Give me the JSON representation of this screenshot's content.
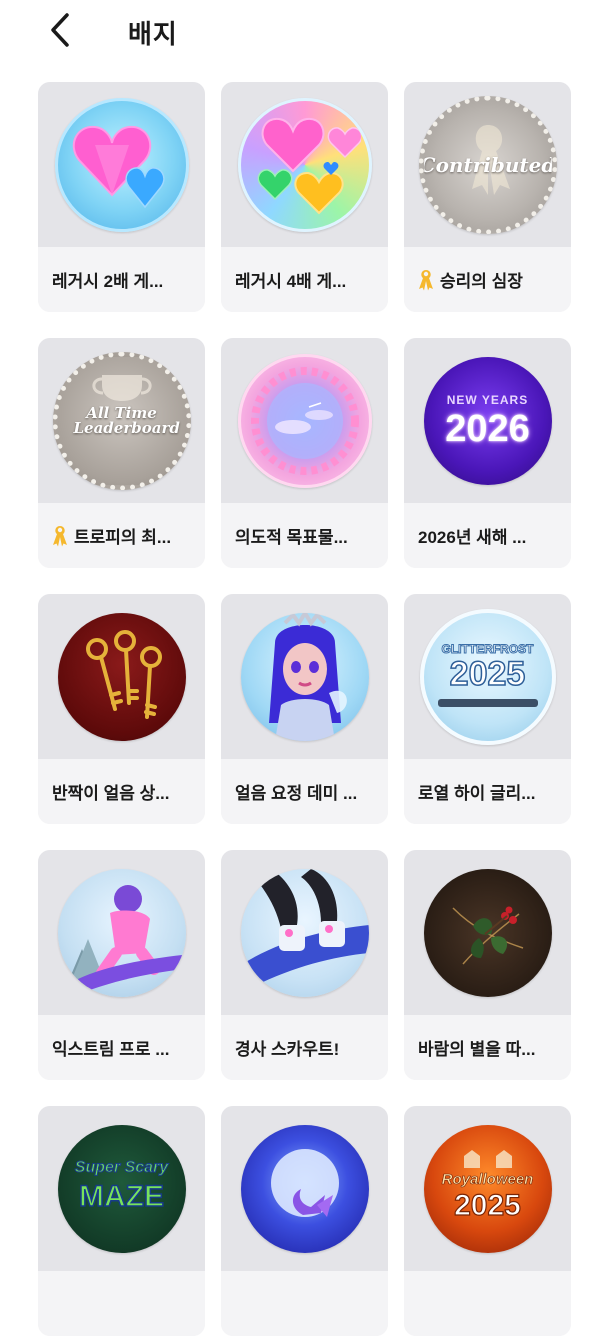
{
  "header": {
    "title": "배지"
  },
  "badges": [
    {
      "name": "레거시 2배 게...",
      "icon": "heart-gems-icon"
    },
    {
      "name": "레거시 4배 게...",
      "icon": "rainbow-hearts-icon"
    },
    {
      "name": "승리의 심장",
      "icon": "contributed-ribbon-icon",
      "ribbon": true,
      "image_text": "Contributed"
    },
    {
      "name": "트로피의 최...",
      "icon": "leaderboard-trophy-icon",
      "ribbon": true,
      "image_text": "All Time Leaderboard"
    },
    {
      "name": "의도적 목표물...",
      "icon": "pink-sky-wreath-icon"
    },
    {
      "name": "2026년 새해 ...",
      "icon": "new-years-2026-icon",
      "image_text_top": "NEW YEARS",
      "image_text": "2026"
    },
    {
      "name": "반짝이 얼음 상...",
      "icon": "golden-keys-icon"
    },
    {
      "name": "얼음 요정 데미 ...",
      "icon": "ice-fairy-avatar-icon"
    },
    {
      "name": "로열 하이 글리...",
      "icon": "glitterfrost-2025-icon",
      "image_text_top": "GLITTERFROST",
      "image_text": "2025"
    },
    {
      "name": "익스트림 프로 ...",
      "icon": "snowboarder-icon"
    },
    {
      "name": "경사 스카우트!",
      "icon": "snowboard-boots-icon"
    },
    {
      "name": "바람의 별을 따...",
      "icon": "holly-sprig-icon"
    },
    {
      "name": "",
      "icon": "super-scary-maze-icon",
      "image_text_top": "Super Scary",
      "image_text": "MAZE"
    },
    {
      "name": "",
      "icon": "mermaid-moon-icon"
    },
    {
      "name": "",
      "icon": "royalloween-2025-icon",
      "image_text_top": "Royalloween",
      "image_text": "2025"
    }
  ],
  "colors": {
    "ribbon": "#f5b82e",
    "card_bg": "#f4f4f6",
    "thumb_bg": "#e4e4e8"
  }
}
